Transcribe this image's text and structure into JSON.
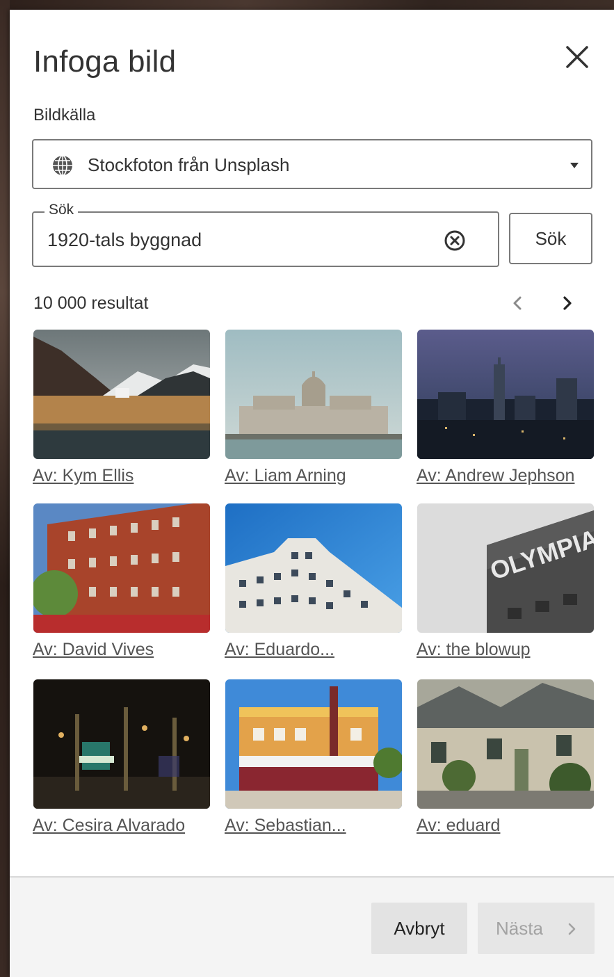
{
  "dialog": {
    "title": "Infoga bild",
    "close_icon": "close-icon"
  },
  "source": {
    "label": "Bildkälla",
    "selected": "Stockfoton från Unsplash",
    "icon": "globe-icon"
  },
  "search": {
    "legend": "Sök",
    "value": "1920-tals byggnad",
    "button_label": "Sök"
  },
  "results": {
    "count_text": "10 000 resultat",
    "items": [
      {
        "credit": "Av: Kym Ellis"
      },
      {
        "credit": "Av: Liam Arning"
      },
      {
        "credit": "Av: Andrew Jephson"
      },
      {
        "credit": "Av: David Vives"
      },
      {
        "credit": "Av: Eduardo..."
      },
      {
        "credit": "Av: the blowup"
      },
      {
        "credit": "Av: Cesira Alvarado"
      },
      {
        "credit": "Av: Sebastian..."
      },
      {
        "credit": "Av: eduard"
      }
    ]
  },
  "footer": {
    "cancel_label": "Avbryt",
    "next_label": "Nästa"
  },
  "colors": {
    "text": "#333333",
    "border": "#7a7a7a",
    "footer_bg": "#f4f4f4",
    "disabled_text": "#a3a3a3"
  }
}
